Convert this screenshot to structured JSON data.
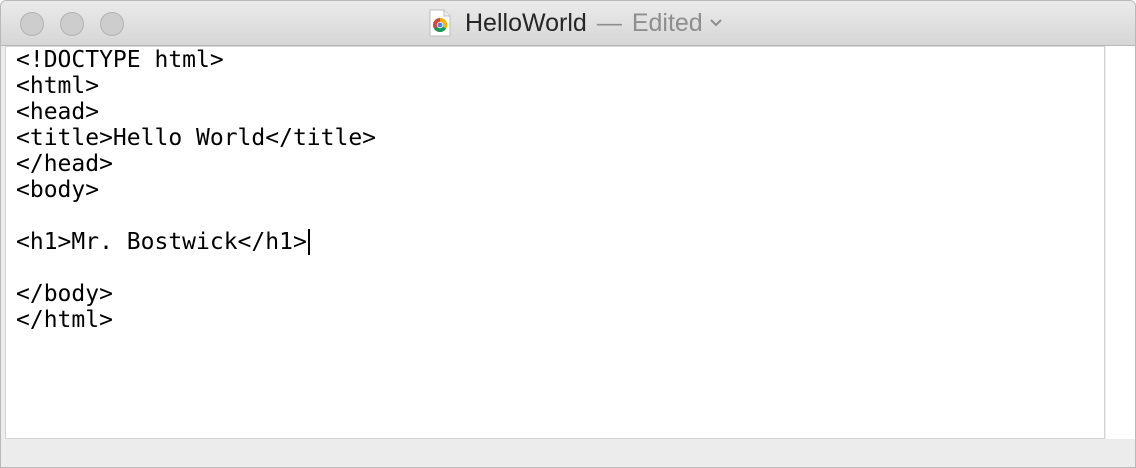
{
  "window": {
    "title": "HelloWorld",
    "separator": "—",
    "status": "Edited",
    "doc_icon": "chrome-html-document-icon",
    "dropdown_icon": "chevron-down-icon"
  },
  "traffic_lights": {
    "close": "close-icon",
    "minimize": "minimize-icon",
    "zoom": "zoom-icon"
  },
  "editor": {
    "lines": [
      "<!DOCTYPE html>",
      "<html>",
      "<head>",
      "<title>Hello World</title>",
      "</head>",
      "<body>",
      "",
      "<h1>Mr. Bostwick</h1>",
      "",
      "</body>",
      "</html>"
    ],
    "cursor_line": 7
  }
}
